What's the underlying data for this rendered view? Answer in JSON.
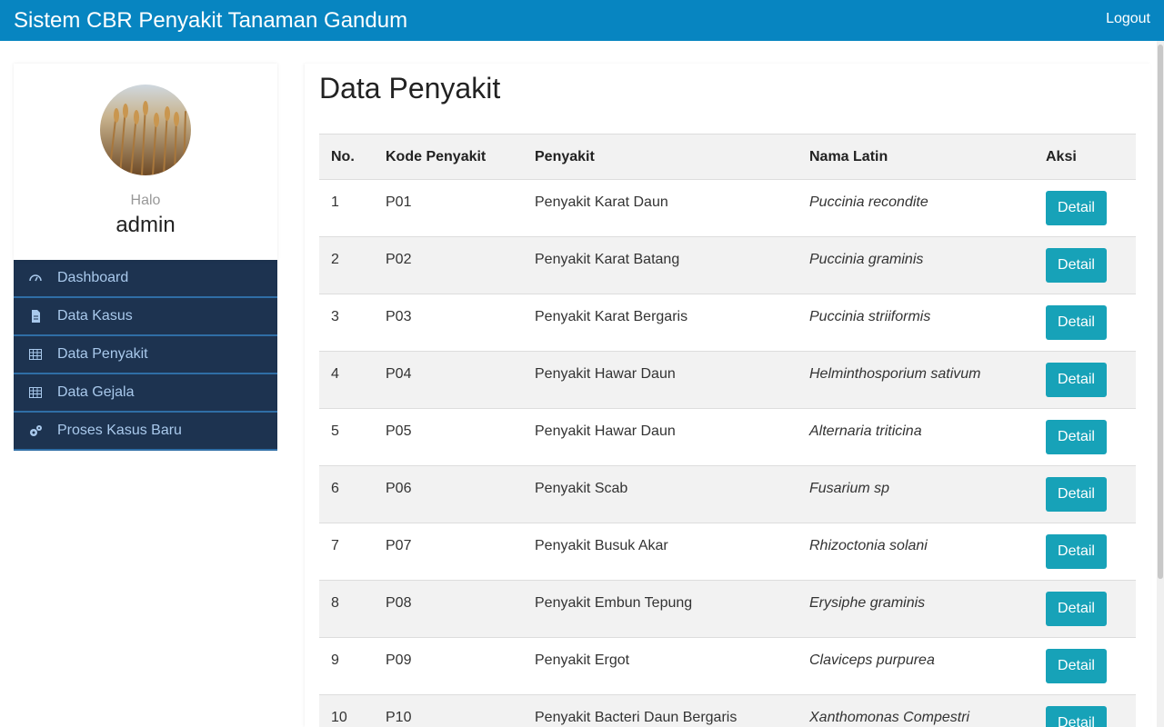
{
  "header": {
    "title": "Sistem CBR Penyakit Tanaman Gandum",
    "logout_label": "Logout"
  },
  "profile": {
    "greeting": "Halo",
    "username": "admin"
  },
  "sidebar": {
    "items": [
      {
        "label": "Dashboard",
        "icon": "dashboard-icon"
      },
      {
        "label": "Data Kasus",
        "icon": "document-icon"
      },
      {
        "label": "Data Penyakit",
        "icon": "table-icon"
      },
      {
        "label": "Data Gejala",
        "icon": "table-icon"
      },
      {
        "label": "Proses Kasus Baru",
        "icon": "gears-icon"
      }
    ]
  },
  "main": {
    "title": "Data Penyakit",
    "columns": [
      "No.",
      "Kode Penyakit",
      "Penyakit",
      "Nama Latin",
      "Aksi"
    ],
    "action_label": "Detail",
    "rows": [
      {
        "no": "1",
        "kode": "P01",
        "penyakit": "Penyakit Karat Daun",
        "latin": "Puccinia recondite"
      },
      {
        "no": "2",
        "kode": "P02",
        "penyakit": "Penyakit Karat Batang",
        "latin": "Puccinia graminis"
      },
      {
        "no": "3",
        "kode": "P03",
        "penyakit": "Penyakit Karat Bergaris",
        "latin": "Puccinia striiformis"
      },
      {
        "no": "4",
        "kode": "P04",
        "penyakit": "Penyakit Hawar Daun",
        "latin": "Helminthosporium sativum"
      },
      {
        "no": "5",
        "kode": "P05",
        "penyakit": "Penyakit Hawar Daun",
        "latin": "Alternaria triticina"
      },
      {
        "no": "6",
        "kode": "P06",
        "penyakit": "Penyakit Scab",
        "latin": "Fusarium sp"
      },
      {
        "no": "7",
        "kode": "P07",
        "penyakit": "Penyakit Busuk Akar",
        "latin": "Rhizoctonia solani"
      },
      {
        "no": "8",
        "kode": "P08",
        "penyakit": "Penyakit Embun Tepung",
        "latin": "Erysiphe graminis"
      },
      {
        "no": "9",
        "kode": "P09",
        "penyakit": "Penyakit Ergot",
        "latin": "Claviceps purpurea"
      },
      {
        "no": "10",
        "kode": "P10",
        "penyakit": "Penyakit Bacteri Daun Bergaris",
        "latin": "Xanthomonas Compestri"
      }
    ]
  },
  "colors": {
    "navbar": "#0785c1",
    "sidebar": "#1d3350",
    "sidebar_text": "#a9c9ec",
    "button": "#17a2b8"
  }
}
